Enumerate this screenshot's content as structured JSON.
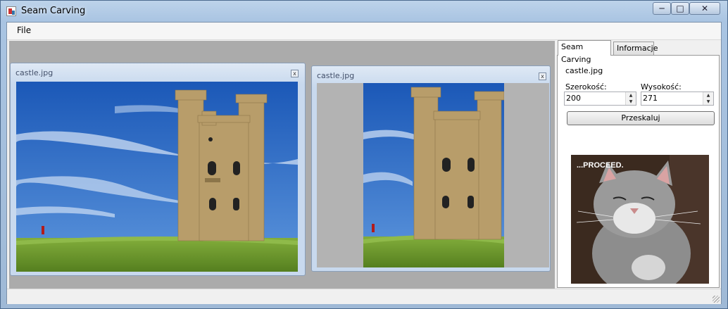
{
  "window": {
    "title": "Seam Carving",
    "minimize": "─",
    "maximize": "□",
    "close": "✕"
  },
  "menu": {
    "file": "File"
  },
  "children": [
    {
      "title": "castle.jpg",
      "close": "x"
    },
    {
      "title": "castle.jpg",
      "close": "x"
    }
  ],
  "panel": {
    "tabs": [
      {
        "label": "Seam Carving"
      },
      {
        "label": "Informacje"
      }
    ],
    "filename": "castle.jpg",
    "width_label": "Szerokość:",
    "height_label": "Wysokość:",
    "width_value": "200",
    "height_value": "271",
    "resize_button": "Przeskaluj",
    "meme_text": "...PROCEED."
  },
  "colors": {
    "sky": "#2b6bc9",
    "grass": "#6a9a2a",
    "stone": "#b89d6a"
  }
}
